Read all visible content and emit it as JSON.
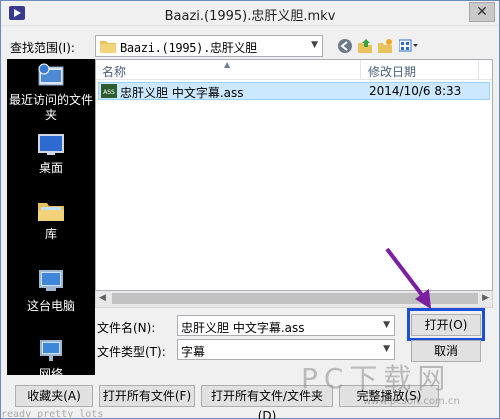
{
  "window": {
    "title": "Baazi.(1995).忠肝义胆.mkv"
  },
  "lookin": {
    "label": "查找范围(I):",
    "value": "Baazi.(1995).忠肝义胆"
  },
  "places": [
    {
      "label": "最近访问的文件夹",
      "icon": "recent-places-icon"
    },
    {
      "label": "桌面",
      "icon": "desktop-icon"
    },
    {
      "label": "库",
      "icon": "libraries-icon"
    },
    {
      "label": "这台电脑",
      "icon": "this-pc-icon"
    },
    {
      "label": "网络",
      "icon": "network-icon"
    }
  ],
  "list": {
    "col_name": "名称",
    "col_date": "修改日期",
    "files": [
      {
        "name": "忠肝义胆 中文字幕.ass",
        "date": "2014/10/6 8:33",
        "icon": "ass-file-icon"
      }
    ]
  },
  "filename": {
    "label": "文件名(N):",
    "value": "忠肝义胆 中文字幕.ass"
  },
  "filetype": {
    "label": "文件类型(T):",
    "value": "字幕"
  },
  "buttons": {
    "open": "打开(O)",
    "cancel": "取消",
    "favorites": "收藏夹(A)",
    "open_all_files": "打开所有文件(F)",
    "open_all_files_folders": "打开所有文件/文件夹(D)",
    "play_folder": "完整播放(S)"
  },
  "watermark": {
    "text": "PC下载网",
    "url": "www.pcsoft.com.cn"
  },
  "background_text": "ready pretty lots",
  "colors": {
    "accent": "#1c4fd8",
    "selection": "#cce8ff",
    "annotation_arrow": "#7b1fa2"
  }
}
